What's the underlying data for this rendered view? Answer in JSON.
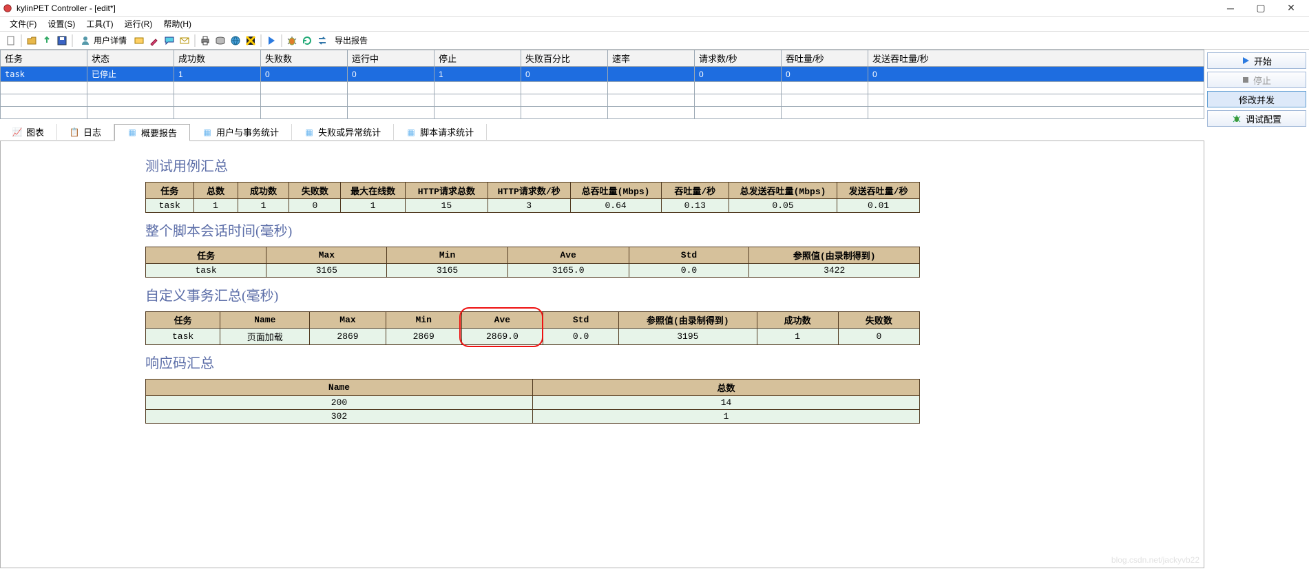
{
  "window": {
    "title": "kylinPET Controller - [edit*]"
  },
  "menubar": {
    "items": [
      "文件(F)",
      "设置(S)",
      "工具(T)",
      "运行(R)",
      "帮助(H)"
    ]
  },
  "toolbar": {
    "user_details": "用户详情",
    "export_report": "导出报告"
  },
  "side": {
    "start": "开始",
    "stop": "停止",
    "modify_dev": "修改并发",
    "debug_cfg": "调试配置"
  },
  "grid": {
    "headers": [
      "任务",
      "状态",
      "成功数",
      "失败数",
      "运行中",
      "停止",
      "失败百分比",
      "速率",
      "请求数/秒",
      "吞吐量/秒",
      "发送吞吐量/秒"
    ],
    "rows": [
      [
        "task",
        "已停止",
        "1",
        "0",
        "0",
        "1",
        "0",
        "",
        "0",
        "0",
        "0"
      ]
    ]
  },
  "tabs": {
    "items": [
      {
        "icon": "chart",
        "label": "图表"
      },
      {
        "icon": "log",
        "label": "日志"
      },
      {
        "icon": "summary",
        "label": "概要报告"
      },
      {
        "icon": "users",
        "label": "用户与事务统计"
      },
      {
        "icon": "fail",
        "label": "失败或异常统计"
      },
      {
        "icon": "script",
        "label": "脚本请求统计"
      }
    ],
    "active_index": 2
  },
  "report": {
    "s1_title": "测试用例汇总",
    "s1_headers": [
      "任务",
      "总数",
      "成功数",
      "失败数",
      "最大在线数",
      "HTTP请求总数",
      "HTTP请求数/秒",
      "总吞吐量(Mbps)",
      "吞吐量/秒",
      "总发送吞吐量(Mbps)",
      "发送吞吐量/秒"
    ],
    "s1_row": [
      "task",
      "1",
      "1",
      "0",
      "1",
      "15",
      "3",
      "0.64",
      "0.13",
      "0.05",
      "0.01"
    ],
    "s2_title": "整个脚本会话时间(毫秒)",
    "s2_headers": [
      "任务",
      "Max",
      "Min",
      "Ave",
      "Std",
      "参照值(由录制得到)"
    ],
    "s2_row": [
      "task",
      "3165",
      "3165",
      "3165.0",
      "0.0",
      "3422"
    ],
    "s3_title": "自定义事务汇总(毫秒)",
    "s3_headers": [
      "任务",
      "Name",
      "Max",
      "Min",
      "Ave",
      "Std",
      "参照值(由录制得到)",
      "成功数",
      "失败数"
    ],
    "s3_row": [
      "task",
      "页面加载",
      "2869",
      "2869",
      "2869.0",
      "0.0",
      "3195",
      "1",
      "0"
    ],
    "s4_title": "响应码汇总",
    "s4_headers": [
      "Name",
      "总数"
    ],
    "s4_rows": [
      [
        "200",
        "14"
      ],
      [
        "302",
        "1"
      ]
    ]
  },
  "watermark": "blog.csdn.net/jackyvb22"
}
